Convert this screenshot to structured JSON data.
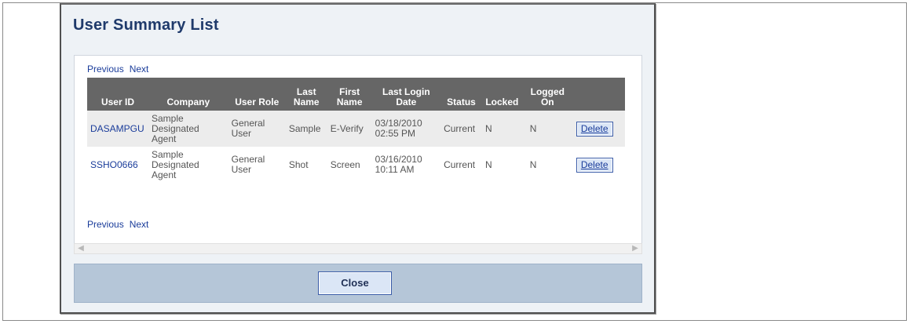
{
  "dialog": {
    "title": "User Summary List",
    "close_label": "Close"
  },
  "pager": {
    "previous": "Previous",
    "next": "Next"
  },
  "table": {
    "headers": {
      "user_id": "User ID",
      "company": "Company",
      "user_role": "User Role",
      "last_name_1": "Last",
      "last_name_2": "Name",
      "first_name_1": "First",
      "first_name_2": "Name",
      "last_login_1": "Last Login",
      "last_login_2": "Date",
      "status": "Status",
      "locked": "Locked",
      "logged_on_1": "Logged",
      "logged_on_2": "On"
    },
    "rows": [
      {
        "user_id": "DASAMPGU",
        "company_1": "Sample",
        "company_2": "Designated",
        "company_3": "Agent",
        "role_1": "General",
        "role_2": "User",
        "last_name": "Sample",
        "first_name": "E-Verify",
        "login_date": "03/18/2010",
        "login_time": "02:55 PM",
        "status": "Current",
        "locked": "N",
        "logged_on": "N",
        "action": "Delete"
      },
      {
        "user_id": "SSHO0666",
        "company_1": "Sample",
        "company_2": "Designated",
        "company_3": "Agent",
        "role_1": "General",
        "role_2": "User",
        "last_name": "Shot",
        "first_name": "Screen",
        "login_date": "03/16/2010",
        "login_time": "10:11 AM",
        "status": "Current",
        "locked": "N",
        "logged_on": "N",
        "action": "Delete"
      }
    ]
  },
  "icons": {
    "scroll_left": "scroll-left-arrow-icon",
    "scroll_right": "scroll-right-arrow-icon"
  },
  "colors": {
    "title": "#1f3a6b",
    "link": "#1a3c9a",
    "header_bg": "#666666",
    "footer_bg": "#b5c6d8"
  }
}
